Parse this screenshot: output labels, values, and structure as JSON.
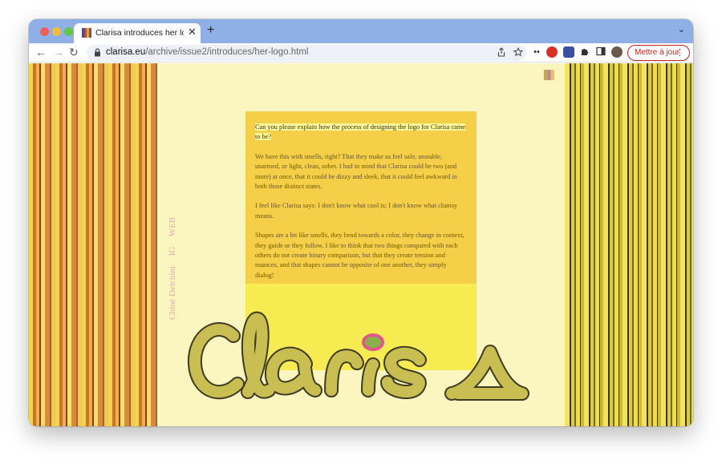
{
  "browser": {
    "tab_title": "Clarisa introduces her logo by",
    "tab_close": "✕",
    "new_tab": "+",
    "tab_menu": "⌄",
    "nav": {
      "back": "←",
      "forward": "→",
      "reload": "↻"
    },
    "url_host": "clarisa.eu",
    "url_path": "/archive/issue2/introduces/her-logo.html",
    "update_label": "Mettre à jour",
    "update_menu": "⋮"
  },
  "page": {
    "side_links": {
      "author": "Chloé Delchini",
      "ig": "IG",
      "web": "WEB"
    },
    "question": "Can you please explain how the process of designing the logo for Clarisa came to be?",
    "paragraphs": [
      "We have this with smells, right? That they make us feel safe, unstable, unarmed, or light, clean, sober. I had in mind that Clarisa could be two (and more) at once, that it could be dizzy and sleek, that it could feel awkward in both those distinct states.",
      "I feel like Clarisa says: I don't know what cool is; I don't know what clumsy means.",
      "Shapes are a bit like smells, they bend towards a color, they change in context, they guide or they follow. I like to think that two things compared with each others do not create binary comparison, but that they create tension and nuances, and that shapes cannot be opposite of one another, they simply dialog!"
    ],
    "logo_text": "clarisa"
  },
  "colors": {
    "page_bg": "#fbf6bf",
    "panel": "#f4cf47",
    "logo_fill": "#c8be52",
    "logo_stroke": "#3f3a22",
    "dot_fill": "#8ab04a",
    "dot_ring": "#e0588a",
    "link_pink": "#e6a7b5"
  }
}
